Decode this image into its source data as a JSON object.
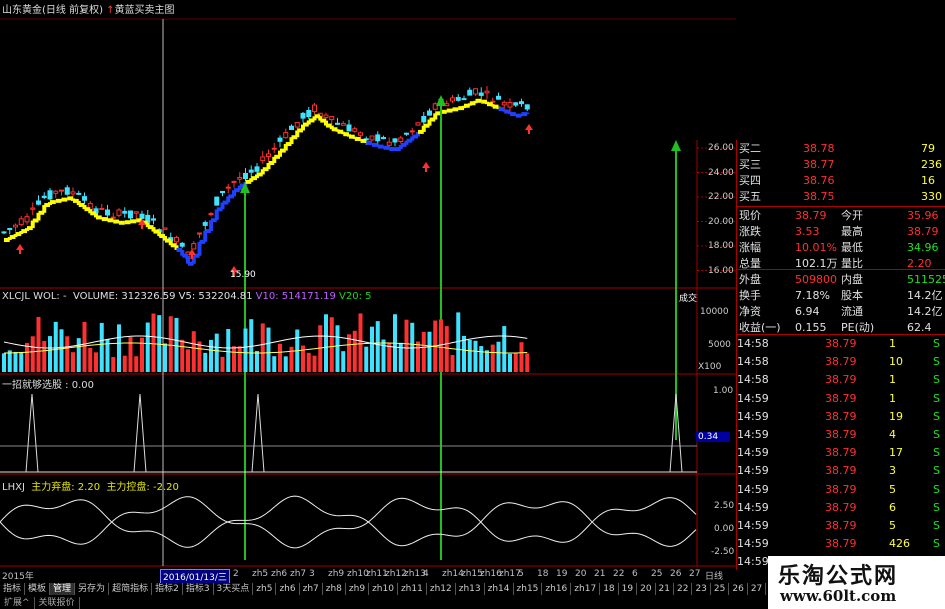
{
  "title": {
    "stock": "山东黄金(日线 前复权)",
    "indicator": "黄蓝买卖主图"
  },
  "price_axis": [
    "26.00",
    "24.00",
    "22.00",
    "20.00",
    "18.00",
    "16.00"
  ],
  "low_marker": "15.90",
  "volume_panel": {
    "label": "XLCJL WOL: -",
    "volume": "VOLUME: 312326.59",
    "v5": "V5: 532204.81",
    "v10": "V10: 514171.19",
    "v20": "V20: 5",
    "axis": [
      "10000",
      "5000",
      "X100"
    ],
    "deal_label": "成交"
  },
  "signal_panel": {
    "label": "一招就够选股 : 0.00",
    "axis": [
      "1.00",
      "0.34"
    ]
  },
  "force_panel": {
    "label": "LHXJ",
    "abandon": "主力弃盘: 2.20",
    "control": "主力控盘: -2.20",
    "axis": [
      "2.50",
      "0.00",
      "-2.50"
    ]
  },
  "x_axis": {
    "year": "2015年",
    "date": "2016/01/13/三",
    "ticks": [
      "2",
      "zh5",
      "zh6",
      "zh7",
      "3",
      "zh9",
      "zh10",
      "zh11",
      "zh12",
      "zh13",
      "4",
      "zh14",
      "zh15",
      "zh16",
      "zh17",
      "5",
      "18",
      "19",
      "20",
      "21",
      "22",
      "6",
      "25",
      "26",
      "27"
    ],
    "period": "日线"
  },
  "tabs": [
    "指标",
    "模板",
    "管理",
    "另存为",
    "超简指标",
    "指标2",
    "指标3",
    "3天买点",
    "zh5",
    "zh6",
    "zh7",
    "zh8",
    "zh9",
    "zh10",
    "zh11",
    "zh12",
    "zh13",
    "zh14",
    "zh15",
    "zh16",
    "zh17",
    "18",
    "19",
    "20",
    "21",
    "22",
    "23",
    "25",
    "26",
    "27"
  ],
  "tabs2": [
    "扩展^",
    "关联报价"
  ],
  "active_tab": "管理",
  "quote": {
    "bids": [
      {
        "label": "买二",
        "price": "38.78",
        "vol": "79"
      },
      {
        "label": "买三",
        "price": "38.77",
        "vol": "236"
      },
      {
        "label": "买四",
        "price": "38.76",
        "vol": "16"
      },
      {
        "label": "买五",
        "price": "38.75",
        "vol": "330"
      }
    ],
    "stats": [
      {
        "l1": "现价",
        "v1": "38.79",
        "l2": "今开",
        "v2": "35.96"
      },
      {
        "l1": "涨跌",
        "v1": "3.53",
        "l2": "最高",
        "v2": "38.79"
      },
      {
        "l1": "涨幅",
        "v1": "10.01%",
        "l2": "最低",
        "v2": "34.96"
      },
      {
        "l1": "总量",
        "v1": "102.1万",
        "l2": "量比",
        "v2": "2.20"
      },
      {
        "l1": "外盘",
        "v1": "509800",
        "l2": "内盘",
        "v2": "511525"
      },
      {
        "l1": "换手",
        "v1": "7.18%",
        "l2": "股本",
        "v2": "14.2亿"
      },
      {
        "l1": "净资",
        "v1": "6.94",
        "l2": "流通",
        "v2": "14.2亿"
      },
      {
        "l1": "收益(一)",
        "v1": "0.155",
        "l2": "PE(动)",
        "v2": "62.4"
      }
    ],
    "ticks": [
      {
        "time": "14:58",
        "price": "38.79",
        "vol": "1",
        "side": "S"
      },
      {
        "time": "14:58",
        "price": "38.79",
        "vol": "10",
        "side": "S"
      },
      {
        "time": "14:58",
        "price": "38.79",
        "vol": "1",
        "side": "S"
      },
      {
        "time": "14:59",
        "price": "38.79",
        "vol": "1",
        "side": "S"
      },
      {
        "time": "14:59",
        "price": "38.79",
        "vol": "19",
        "side": "S"
      },
      {
        "time": "14:59",
        "price": "38.79",
        "vol": "4",
        "side": "S"
      },
      {
        "time": "14:59",
        "price": "38.79",
        "vol": "17",
        "side": "S"
      },
      {
        "time": "14:59",
        "price": "38.79",
        "vol": "3",
        "side": "S"
      },
      {
        "time": "14:59",
        "price": "38.79",
        "vol": "5",
        "side": "S"
      },
      {
        "time": "14:59",
        "price": "38.79",
        "vol": "6",
        "side": "S"
      },
      {
        "time": "14:59",
        "price": "38.79",
        "vol": "5",
        "side": "S"
      },
      {
        "time": "14:59",
        "price": "38.79",
        "vol": "426",
        "side": "S"
      },
      {
        "time": "14:59",
        "price": "38.79",
        "vol": "43",
        "side": "S"
      }
    ]
  },
  "watermark": {
    "name": "乐淘公式网",
    "url": "www.60lt.com"
  },
  "colors": {
    "up": "#ff3030",
    "down": "#40e0ff",
    "line_yellow": "#ffff00",
    "line_blue": "#2040ff",
    "arrow_green": "#20c020",
    "grid": "#a00000"
  }
}
